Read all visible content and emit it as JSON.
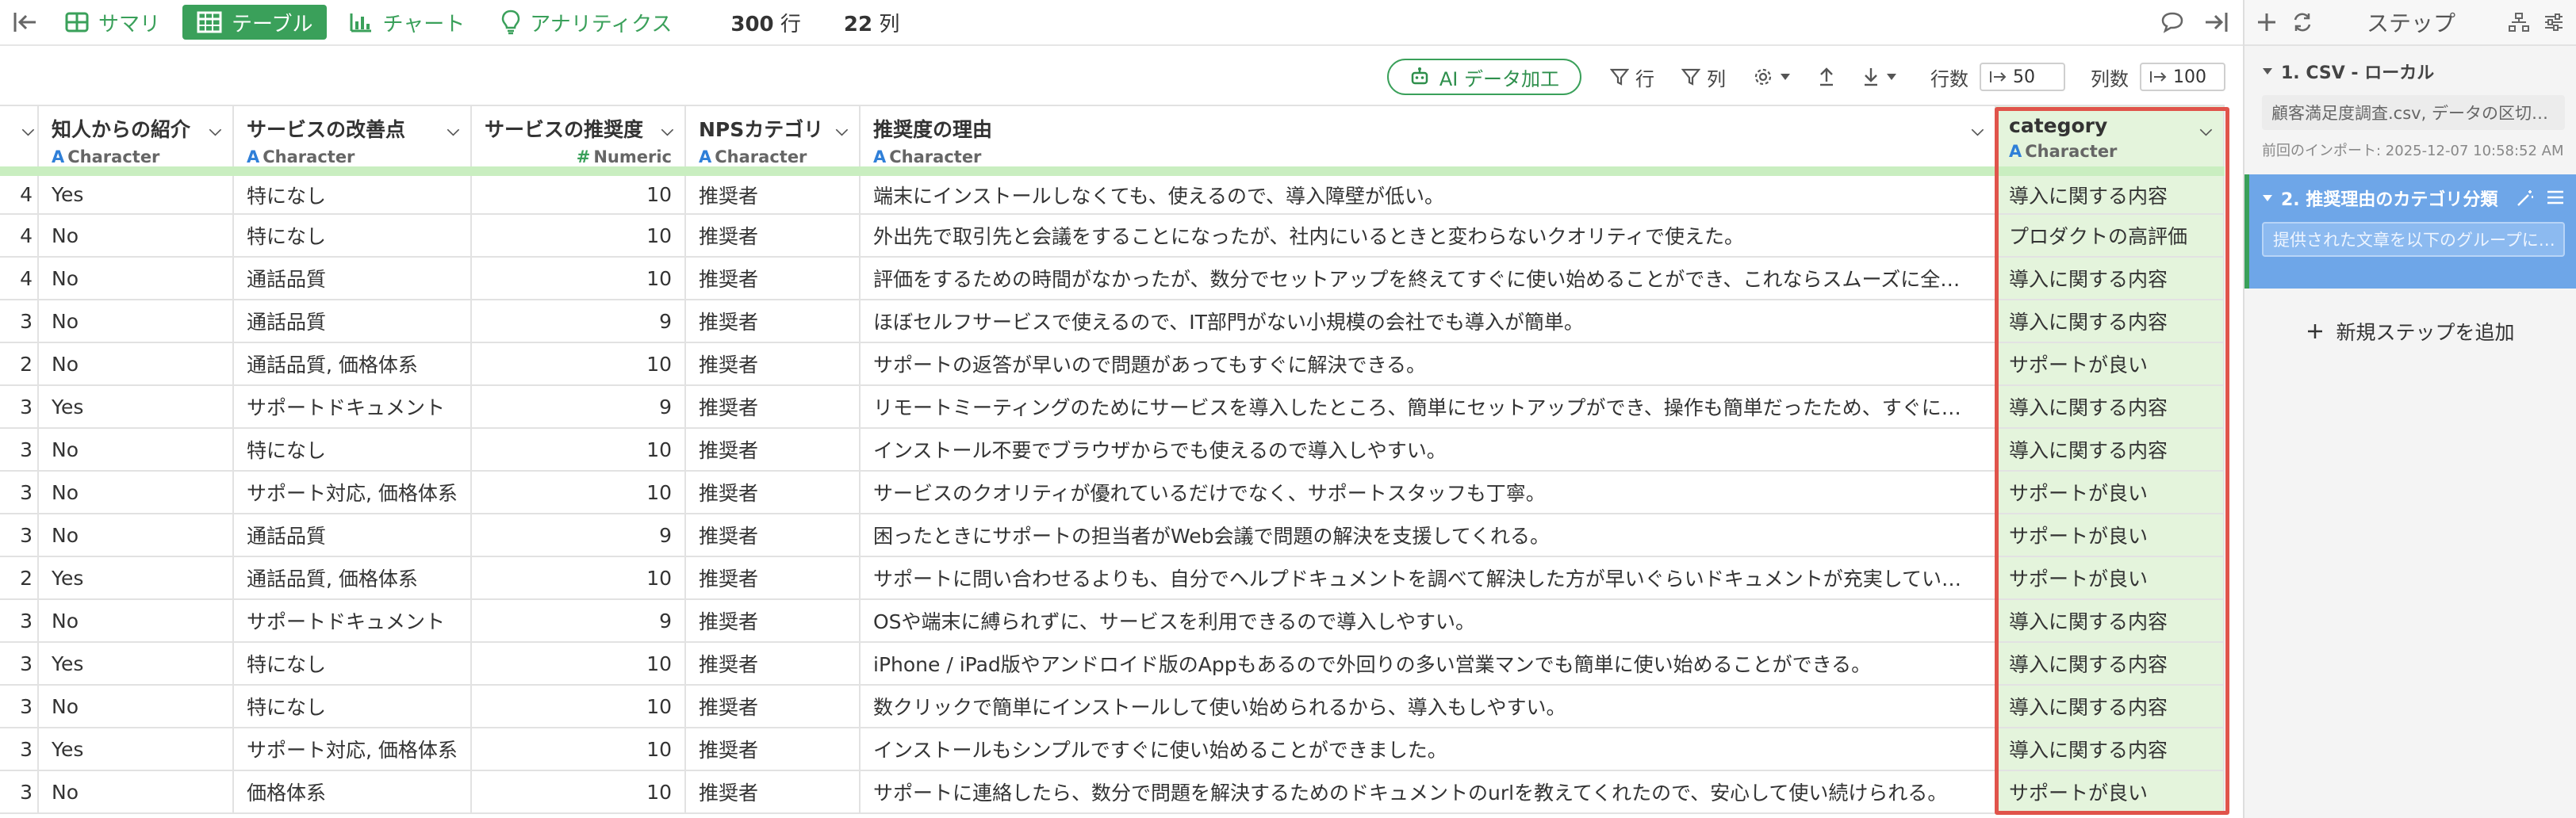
{
  "topbar": {
    "tabs": [
      {
        "label": "サマリ",
        "icon": "summary-grid-icon",
        "active": false
      },
      {
        "label": "テーブル",
        "icon": "table-icon",
        "active": true
      },
      {
        "label": "チャート",
        "icon": "bar-chart-icon",
        "active": false
      },
      {
        "label": "アナリティクス",
        "icon": "lightbulb-icon",
        "active": false
      }
    ],
    "row_count": "300",
    "row_unit": "行",
    "col_count": "22",
    "col_unit": "列"
  },
  "toolbar": {
    "ai_label": "AI データ加工",
    "filter_row_label": "行",
    "filter_col_label": "列",
    "rows_label": "行数",
    "rows_value": "50",
    "cols_label": "列数",
    "cols_value": "100"
  },
  "table": {
    "columns": [
      {
        "name": "知人からの紹介",
        "type": "Character"
      },
      {
        "name": "サービスの改善点",
        "type": "Character"
      },
      {
        "name": "サービスの推奨度",
        "type": "Numeric"
      },
      {
        "name": "NPSカテゴリ",
        "type": "Character"
      },
      {
        "name": "推奨度の理由",
        "type": "Character"
      },
      {
        "name": "category",
        "type": "Character"
      }
    ],
    "type_icon_char": "A",
    "type_icon_num": "#",
    "rows": [
      {
        "idx": "4",
        "c1": "Yes",
        "c2": "特になし",
        "c3": "10",
        "c4": "推奨者",
        "c5": "端末にインストールしなくても、使えるので、導入障壁が低い。",
        "c6": "導入に関する内容"
      },
      {
        "idx": "4",
        "c1": "No",
        "c2": "特になし",
        "c3": "10",
        "c4": "推奨者",
        "c5": "外出先で取引先と会議をすることになったが、社内にいるときと変わらないクオリティで使えた。",
        "c6": "プロダクトの高評価"
      },
      {
        "idx": "4",
        "c1": "No",
        "c2": "通話品質",
        "c3": "10",
        "c4": "推奨者",
        "c5": "評価をするための時間がなかったが、数分でセットアップを終えてすぐに使い始めることができ、これならスムーズに全…",
        "c6": "導入に関する内容"
      },
      {
        "idx": "3",
        "c1": "No",
        "c2": "通話品質",
        "c3": "9",
        "c4": "推奨者",
        "c5": "ほぼセルフサービスで使えるので、IT部門がない小規模の会社でも導入が簡単。",
        "c6": "導入に関する内容"
      },
      {
        "idx": "2",
        "c1": "No",
        "c2": "通話品質, 価格体系",
        "c3": "10",
        "c4": "推奨者",
        "c5": "サポートの返答が早いので問題があってもすぐに解決できる。",
        "c6": "サポートが良い"
      },
      {
        "idx": "3",
        "c1": "Yes",
        "c2": "サポートドキュメント",
        "c3": "9",
        "c4": "推奨者",
        "c5": "リモートミーティングのためにサービスを導入したところ、簡単にセットアップができ、操作も簡単だったため、すぐに…",
        "c6": "導入に関する内容"
      },
      {
        "idx": "3",
        "c1": "No",
        "c2": "特になし",
        "c3": "10",
        "c4": "推奨者",
        "c5": "インストール不要でブラウザからでも使えるので導入しやすい。",
        "c6": "導入に関する内容"
      },
      {
        "idx": "3",
        "c1": "No",
        "c2": "サポート対応, 価格体系",
        "c3": "10",
        "c4": "推奨者",
        "c5": "サービスのクオリティが優れているだけでなく、サポートスタッフも丁寧。",
        "c6": "サポートが良い"
      },
      {
        "idx": "3",
        "c1": "No",
        "c2": "通話品質",
        "c3": "9",
        "c4": "推奨者",
        "c5": "困ったときにサポートの担当者がWeb会議で問題の解決を支援してくれる。",
        "c6": "サポートが良い"
      },
      {
        "idx": "2",
        "c1": "Yes",
        "c2": "通話品質, 価格体系",
        "c3": "10",
        "c4": "推奨者",
        "c5": "サポートに問い合わせるよりも、自分でヘルプドキュメントを調べて解決した方が早いぐらいドキュメントが充実してい…",
        "c6": "サポートが良い"
      },
      {
        "idx": "3",
        "c1": "No",
        "c2": "サポートドキュメント",
        "c3": "9",
        "c4": "推奨者",
        "c5": "OSや端末に縛られずに、サービスを利用できるので導入しやすい。",
        "c6": "導入に関する内容"
      },
      {
        "idx": "3",
        "c1": "Yes",
        "c2": "特になし",
        "c3": "10",
        "c4": "推奨者",
        "c5": "iPhone / iPad版やアンドロイド版のAppもあるので外回りの多い営業マンでも簡単に使い始めることができる。",
        "c6": "導入に関する内容"
      },
      {
        "idx": "3",
        "c1": "No",
        "c2": "特になし",
        "c3": "10",
        "c4": "推奨者",
        "c5": "数クリックで簡単にインストールして使い始められるから、導入もしやすい。",
        "c6": "導入に関する内容"
      },
      {
        "idx": "3",
        "c1": "Yes",
        "c2": "サポート対応, 価格体系",
        "c3": "10",
        "c4": "推奨者",
        "c5": "インストールもシンプルですぐに使い始めることができました。",
        "c6": "導入に関する内容"
      },
      {
        "idx": "3",
        "c1": "No",
        "c2": "価格体系",
        "c3": "10",
        "c4": "推奨者",
        "c5": "サポートに連絡したら、数分で問題を解決するためのドキュメントのurlを教えてくれたので、安心して使い続けられる。",
        "c6": "サポートが良い"
      }
    ]
  },
  "panel": {
    "title": "ステップ",
    "step1": {
      "title": "1. CSV - ローカル",
      "sub": "顧客満足度調査.csv, データの区切…",
      "meta": "前回のインポート: 2025-12-07 10:58:52 AM"
    },
    "step2": {
      "title": "2. 推奨理由のカテゴリ分類",
      "sub": "提供された文章を以下のグループに…"
    },
    "add_step": "新規ステップを追加"
  },
  "colors": {
    "accent_green": "#3aa05a",
    "highlight_red": "#e0544b",
    "step_blue": "#6ea6e8",
    "category_bg": "#e4f4dc"
  }
}
